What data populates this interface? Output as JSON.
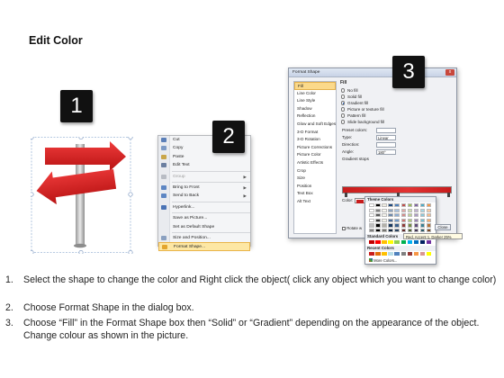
{
  "title": "Edit Color",
  "badges": [
    "1",
    "2",
    "3"
  ],
  "context_menu": {
    "items": [
      {
        "label": "Cut",
        "icon": "scissors-icon",
        "color": "#5b7fb8",
        "type": "item"
      },
      {
        "label": "Copy",
        "icon": "copy-icon",
        "color": "#7d9ac6",
        "type": "item"
      },
      {
        "label": "Paste",
        "icon": "paste-icon",
        "color": "#c9a64a",
        "type": "item"
      },
      {
        "label": "Edit Text",
        "icon": "edit-text-icon",
        "color": "#6b7fa0",
        "type": "item"
      },
      {
        "label": "Group",
        "icon": "group-icon",
        "color": "#b8bcc4",
        "type": "submenu-disabled"
      },
      {
        "label": "Bring to Front",
        "icon": "bring-front-icon",
        "color": "#5d86c3",
        "type": "submenu"
      },
      {
        "label": "Send to Back",
        "icon": "send-back-icon",
        "color": "#5d86c3",
        "type": "submenu"
      },
      {
        "label": "Hyperlink...",
        "icon": "hyperlink-icon",
        "color": "#4a73b5",
        "type": "item"
      },
      {
        "label": "Save as Picture...",
        "icon": "",
        "color": "",
        "type": "item"
      },
      {
        "label": "Set as Default Shape",
        "icon": "",
        "color": "",
        "type": "item"
      },
      {
        "label": "Size and Position...",
        "icon": "size-position-icon",
        "color": "#8aa0c0",
        "type": "item"
      },
      {
        "label": "Format Shape...",
        "icon": "format-shape-icon",
        "color": "#e3a52d",
        "type": "highlight"
      }
    ]
  },
  "dialog": {
    "title": "Format Shape",
    "close_glyph": "x",
    "categories": [
      "Fill",
      "Line Color",
      "Line Style",
      "Shadow",
      "Reflection",
      "Glow and Soft Edges",
      "3-D Format",
      "3-D Rotation",
      "Picture Corrections",
      "Picture Color",
      "Artistic Effects",
      "Crop",
      "Size",
      "Position",
      "Text Box",
      "Alt Text"
    ],
    "selected_category": "Fill",
    "fill_heading": "Fill",
    "fill_options": [
      {
        "label": "No fill",
        "on": false
      },
      {
        "label": "Solid fill",
        "on": false
      },
      {
        "label": "Gradient fill",
        "on": true
      },
      {
        "label": "Picture or texture fill",
        "on": false
      },
      {
        "label": "Pattern fill",
        "on": false
      },
      {
        "label": "Slide background fill",
        "on": false
      }
    ],
    "fields": [
      {
        "label": "Preset colors:",
        "value": ""
      },
      {
        "label": "Type:",
        "value": "Linear"
      },
      {
        "label": "Direction:",
        "value": ""
      },
      {
        "label": "Angle:",
        "value": "180°"
      }
    ],
    "gradient_stops_label": "Gradient stops",
    "color_label": "Color:",
    "position_label": "Position:",
    "position_value": "0%",
    "brightness_label": "Brightness:",
    "transparency_label": "Transparency:",
    "rotate_label": "Rotate w",
    "close_button": "Close"
  },
  "palette": {
    "theme_heading": "Theme Colors",
    "standard_heading": "Standard Colors",
    "recent_heading": "Recent Colors",
    "more_colors": "More Colors...",
    "tooltip": "Red, Accent 1, Darker 25%",
    "theme_colors": [
      "#ffffff",
      "#000000",
      "#eeece1",
      "#1f497d",
      "#4f81bd",
      "#c0504d",
      "#9bbb59",
      "#8064a2",
      "#4bacc6",
      "#f79646"
    ],
    "standard_colors": [
      "#c00000",
      "#ff0000",
      "#ffc000",
      "#ffff00",
      "#92d050",
      "#00b050",
      "#00b0f0",
      "#0070c0",
      "#002060",
      "#7030a0"
    ],
    "recent_colors": [
      "#c81c1c",
      "#e36c09",
      "#ffc000",
      "#b7dde8",
      "#4f81bd",
      "#7f7f7f",
      "#953735",
      "#f79646",
      "#d99694",
      "#ffff00"
    ]
  },
  "steps": [
    {
      "num": "1.",
      "text": "Select the shape to change the color and Right click the object( click any object which you want to change color)"
    },
    {
      "num": "2.",
      "text": "Choose Format Shape in the dialog box."
    },
    {
      "num": "3.",
      "text": "Choose “Fill” in the Format Shape box then “Solid” or “Gradient” depending on the appearance of the object. Change colour as shown in the picture."
    }
  ],
  "colors": {
    "arrow_red": "#d51d1d",
    "menu_highlight": "#fde7a4",
    "badge": "#111111"
  }
}
